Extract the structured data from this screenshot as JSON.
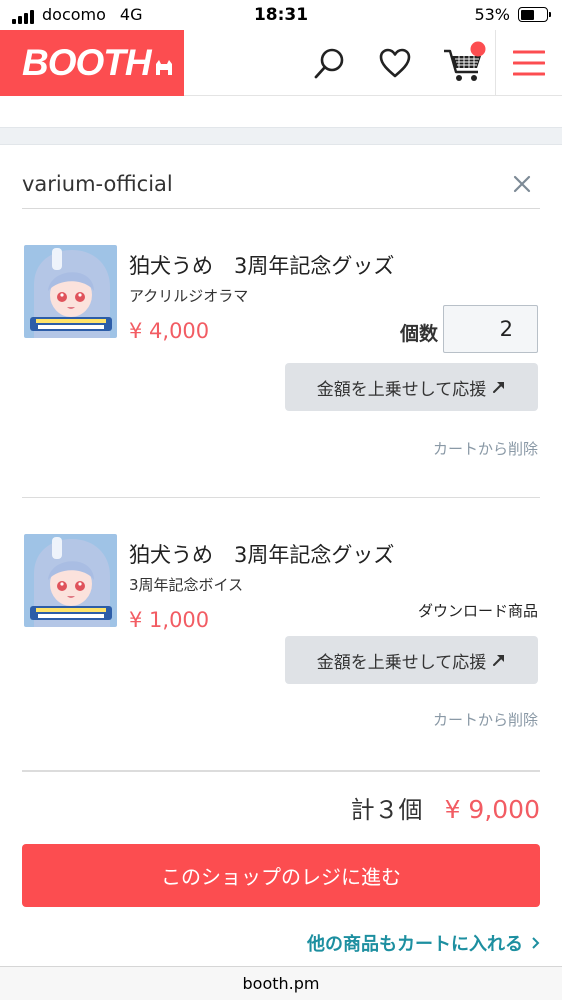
{
  "status_bar": {
    "carrier": "docomo",
    "network": "4G",
    "time": "18:31",
    "battery": "53%",
    "battery_level": 0.53
  },
  "header": {
    "logo_text": "BOOTH",
    "icons": [
      "search-icon",
      "heart-icon",
      "cart-icon",
      "menu-icon"
    ],
    "brand_color": "#fc4d50"
  },
  "shop": {
    "name": "varium-official"
  },
  "items": [
    {
      "title": "狛犬うめ　3周年記念グッズ",
      "variant": "アクリルジオラマ",
      "price": "¥ 4,000",
      "quantity_label": "個数",
      "quantity": "2",
      "support_label": "金額を上乗せして応援",
      "remove_label": "カートから削除"
    },
    {
      "title": "狛犬うめ　3周年記念グッズ",
      "variant": "3周年記念ボイス",
      "price": "¥ 1,000",
      "download_label": "ダウンロード商品",
      "support_label": "金額を上乗せして応援",
      "remove_label": "カートから削除"
    }
  ],
  "summary": {
    "count_label": "計３個",
    "total": "¥ 9,000"
  },
  "checkout_label": "このショップのレジに進む",
  "continue_label": "他の商品もカートに入れる",
  "url": "booth.pm"
}
